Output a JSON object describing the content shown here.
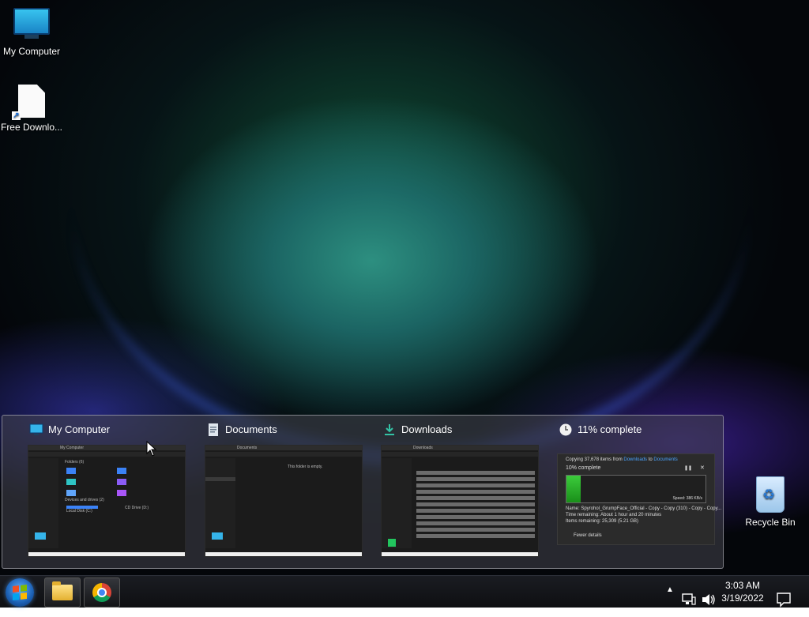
{
  "desktop": {
    "icons": [
      {
        "label": "My Computer",
        "icon": "monitor-icon"
      },
      {
        "label": "Free Downlo...",
        "icon": "file-shortcut-icon"
      },
      {
        "label": "Recycle Bin",
        "icon": "recycle-bin-icon"
      }
    ]
  },
  "taskview": {
    "cards": [
      {
        "title": "My Computer",
        "icon": "monitor-icon",
        "thumb": {
          "path": "My Computer",
          "section": "Folders (6)",
          "drives_section": "Devices and drives (2)",
          "drive1": "Local Disk (C:)",
          "drive2": "CD Drive (D:)"
        }
      },
      {
        "title": "Documents",
        "icon": "document-icon",
        "thumb": {
          "path": "Documents",
          "empty_note": "This folder is empty."
        }
      },
      {
        "title": "Downloads",
        "icon": "download-icon",
        "thumb": {
          "path": "Downloads"
        }
      },
      {
        "title": "11% complete",
        "icon": "clock-icon",
        "progress": {
          "header_prefix": "Copying 37,678 items from ",
          "from": "Downloads",
          "to_word": " to ",
          "to": "Documents",
          "percent_label": "10% complete",
          "percent": 10,
          "speed": "Speed: 386 KB/s",
          "name_line": "Name: Spyrohol_GrumpFace_Official - Copy - Copy (310) - Copy - Copy...",
          "time_line": "Time remaining: About 1 hour and 20 minutes",
          "items_line": "Items remaining: 25,309 (5.21 GB)",
          "fewer_details": "Fewer details"
        }
      }
    ]
  },
  "taskbar": {
    "clock_time": "3:03 AM",
    "clock_date": "3/19/2022"
  }
}
